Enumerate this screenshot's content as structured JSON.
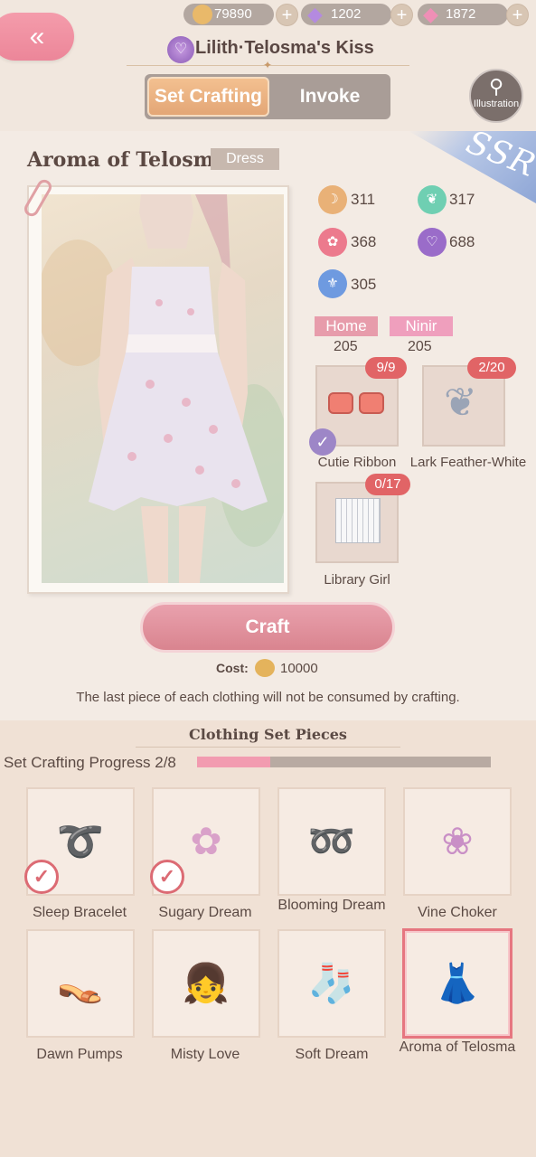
{
  "header": {
    "back_icon": "«",
    "currencies": [
      {
        "name": "gold",
        "value": "79890",
        "color": "#e9b96a"
      },
      {
        "name": "diamond",
        "value": "1202",
        "color": "#b48ae0"
      },
      {
        "name": "star-crystal",
        "value": "1872",
        "color": "#ef8fb6"
      }
    ],
    "plus_label": "+",
    "set_title": "Lilith·Telosma's Kiss",
    "tabs": [
      {
        "label": "Set Crafting",
        "active": true
      },
      {
        "label": "Invoke",
        "active": false
      }
    ],
    "illustration_label": "Illustration"
  },
  "item": {
    "name": "Aroma of Telosma",
    "type": "Dress",
    "rarity": "SSR",
    "stats": [
      {
        "icon": "elegant-icon",
        "value": "311",
        "color": "#e9b177"
      },
      {
        "icon": "fresh-icon",
        "value": "317",
        "color": "#6fcfb2"
      },
      {
        "icon": "sweet-icon",
        "value": "368",
        "color": "#ec7a8d"
      },
      {
        "icon": "sexy-icon",
        "value": "688",
        "color": "#9a6cc9"
      },
      {
        "icon": "cool-icon",
        "value": "305",
        "color": "#6e9ae0"
      }
    ],
    "tags": [
      {
        "label": "Home",
        "value": "205",
        "color": "#e79cab"
      },
      {
        "label": "Ninir",
        "value": "205",
        "color": "#ef9fbd"
      }
    ],
    "materials": [
      {
        "name": "Cutie Ribbon",
        "count": "9/9",
        "complete": true
      },
      {
        "name": "Lark Feather-White",
        "count": "2/20",
        "complete": false
      },
      {
        "name": "Library Girl",
        "count": "0/17",
        "complete": false
      }
    ],
    "craft_label": "Craft",
    "cost_label": "Cost:",
    "cost_value": "10000",
    "notice": "The last piece of each clothing will not be consumed by crafting."
  },
  "pieces": {
    "title": "Clothing Set Pieces",
    "progress_label": "Set Crafting Progress 2/8",
    "progress": 0.25,
    "items": [
      {
        "name": "Sleep Bracelet",
        "owned": true,
        "art": "➰"
      },
      {
        "name": "Sugary Dream",
        "owned": true,
        "art": "✿"
      },
      {
        "name": "Blooming Dream",
        "owned": false,
        "art": "➿"
      },
      {
        "name": "Vine Choker",
        "owned": false,
        "art": "❀"
      },
      {
        "name": "Dawn Pumps",
        "owned": false,
        "art": "👡"
      },
      {
        "name": "Misty Love",
        "owned": false,
        "art": "👧"
      },
      {
        "name": "Soft Dream",
        "owned": false,
        "art": "🧦"
      },
      {
        "name": "Aroma of Telosma",
        "owned": false,
        "selected": true,
        "art": "👗"
      }
    ]
  }
}
